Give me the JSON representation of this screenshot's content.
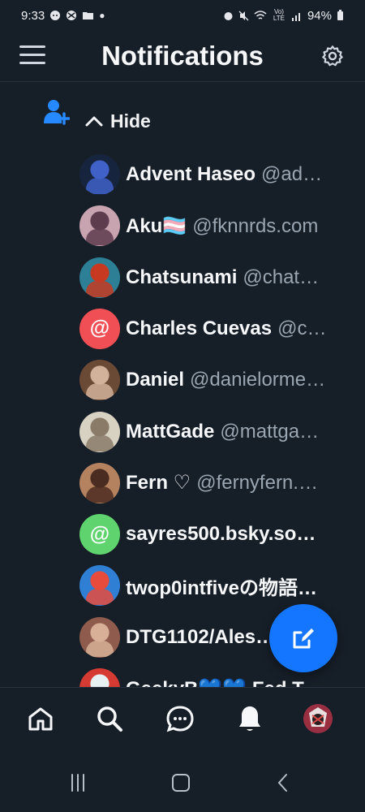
{
  "status": {
    "time": "9:33",
    "battery": "94%",
    "carrier_label": "Vo) LTE",
    "icons": [
      "reddit-icon",
      "xbox-icon",
      "folder-icon",
      "dot-icon",
      "alarm-icon",
      "mute-icon",
      "wifi-icon",
      "signal-icon",
      "battery-icon"
    ]
  },
  "header": {
    "title": "Notifications",
    "menu_icon": "hamburger-menu-icon",
    "settings_icon": "gear-icon"
  },
  "follow_group": {
    "icon": "person-add-icon",
    "toggle_label": "Hide",
    "toggle_icon": "chevron-up-icon",
    "users": [
      {
        "name": "Advent Haseo",
        "handle": "@ad…",
        "avatar": "image",
        "colors": [
          "#17243e",
          "#3f61c8"
        ]
      },
      {
        "name": "Aku🏳️‍⚧️",
        "handle": "@fknnrds.com",
        "avatar": "image",
        "colors": [
          "#c8a3b0",
          "#5d3c4d"
        ]
      },
      {
        "name": "Chatsunami",
        "handle": "@chat…",
        "avatar": "image",
        "colors": [
          "#2c7f95",
          "#c73921"
        ]
      },
      {
        "name": "Charles Cuevas",
        "handle": "@c…",
        "avatar": "default",
        "colors": [
          "#ef4f55"
        ],
        "avatar_glyph": "@"
      },
      {
        "name": "Daniel",
        "handle": "@danielorme…",
        "avatar": "image",
        "colors": [
          "#6b4a35",
          "#d2b29b"
        ]
      },
      {
        "name": "MattGade",
        "handle": "@mattga…",
        "avatar": "image",
        "colors": [
          "#d8d2c3",
          "#8a7b68"
        ]
      },
      {
        "name": "Fern ♡",
        "handle": "@fernyfern.…",
        "avatar": "image",
        "colors": [
          "#b4825f",
          "#4b2c20"
        ]
      },
      {
        "name": "sayres500.bsky.so…",
        "handle": "",
        "avatar": "default",
        "colors": [
          "#5fd36e"
        ],
        "avatar_glyph": "@"
      },
      {
        "name": "twop0intfiveの物語…",
        "handle": "",
        "avatar": "image",
        "colors": [
          "#2f7fd5",
          "#e74b3c"
        ]
      },
      {
        "name": "DTG1102/Ales…",
        "handle": "",
        "avatar": "image",
        "colors": [
          "#8f5b4c",
          "#d7b097"
        ]
      },
      {
        "name": "GeekyB💙💙 Fed T…",
        "handle": "",
        "avatar": "image",
        "colors": [
          "#d53b32",
          "#e7f0f2"
        ]
      }
    ]
  },
  "compose": {
    "icon": "compose-icon",
    "color": "#1476ff"
  },
  "bottom_nav": [
    {
      "icon": "home-icon"
    },
    {
      "icon": "search-icon"
    },
    {
      "icon": "chat-bubble-icon"
    },
    {
      "icon": "bell-icon"
    },
    {
      "icon": "profile-avatar-icon"
    }
  ],
  "android_nav": [
    "recent-apps-icon",
    "home-circle-icon",
    "back-icon"
  ],
  "theme": {
    "background": "#161e27",
    "text": "#f5f7f9",
    "muted": "#9aa6b2",
    "accent": "#1476ff"
  }
}
